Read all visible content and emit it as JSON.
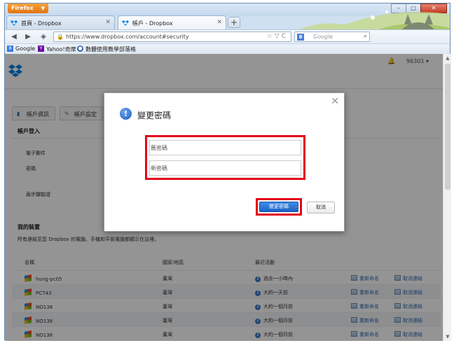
{
  "browser": {
    "menu_label": "Firefox",
    "tabs": [
      {
        "label": "首頁 - Dropbox"
      },
      {
        "label": "帳戶 - Dropbox"
      }
    ],
    "url": "https://www.dropbox.com/account#security",
    "search_placeholder": "Google",
    "search_engine_letter": "8",
    "bookmarks": [
      {
        "label": "Google",
        "color": "#3b78e7",
        "glyph": "8"
      },
      {
        "label": "Yahoo!奇摩",
        "color": "#6b0aa0",
        "glyph": "Y"
      },
      {
        "label": "數體使用教學部落格",
        "color": "#2f5fa7",
        "glyph": "●"
      }
    ]
  },
  "dropbox": {
    "username": "96301",
    "tabs": [
      {
        "label": "帳戶資訊"
      },
      {
        "label": "帳戶設定"
      }
    ],
    "login_section": {
      "title": "帳戶登入",
      "labels": [
        "電子郵件",
        "密碼",
        "兩步驟驗證"
      ]
    },
    "devices_section": {
      "title": "我的裝置",
      "subtitle": "所有連結至您 Dropbox 的電腦、手機和平板電腦都顯示在這裡。",
      "columns": [
        "名稱",
        "國家/地區",
        "最近活動"
      ],
      "rows": [
        {
          "name": "hung-pc05",
          "country": "臺灣",
          "activity": "過去一小時內",
          "rename": "重新命名",
          "unlink": "取消連結"
        },
        {
          "name": "PC743",
          "country": "臺灣",
          "activity": "大約一天前",
          "rename": "重新命名",
          "unlink": "取消連結"
        },
        {
          "name": "NO138",
          "country": "臺灣",
          "activity": "大約一個月前",
          "rename": "重新命名",
          "unlink": "取消連結"
        },
        {
          "name": "NO138",
          "country": "臺灣",
          "activity": "大約一個月前",
          "rename": "重新命名",
          "unlink": "取消連結"
        },
        {
          "name": "NO138",
          "country": "臺灣",
          "activity": "大約一個月前",
          "rename": "重新命名",
          "unlink": "取消連結"
        }
      ]
    }
  },
  "modal": {
    "title": "變更密碼",
    "old_password_placeholder": "舊密碼",
    "new_password_placeholder": "新密碼",
    "submit_label": "變更密碼",
    "cancel_label": "取消"
  },
  "colors": {
    "highlight": "#e3001b",
    "primary_button": "#1c63c8",
    "dropbox_blue": "#007ee5"
  }
}
